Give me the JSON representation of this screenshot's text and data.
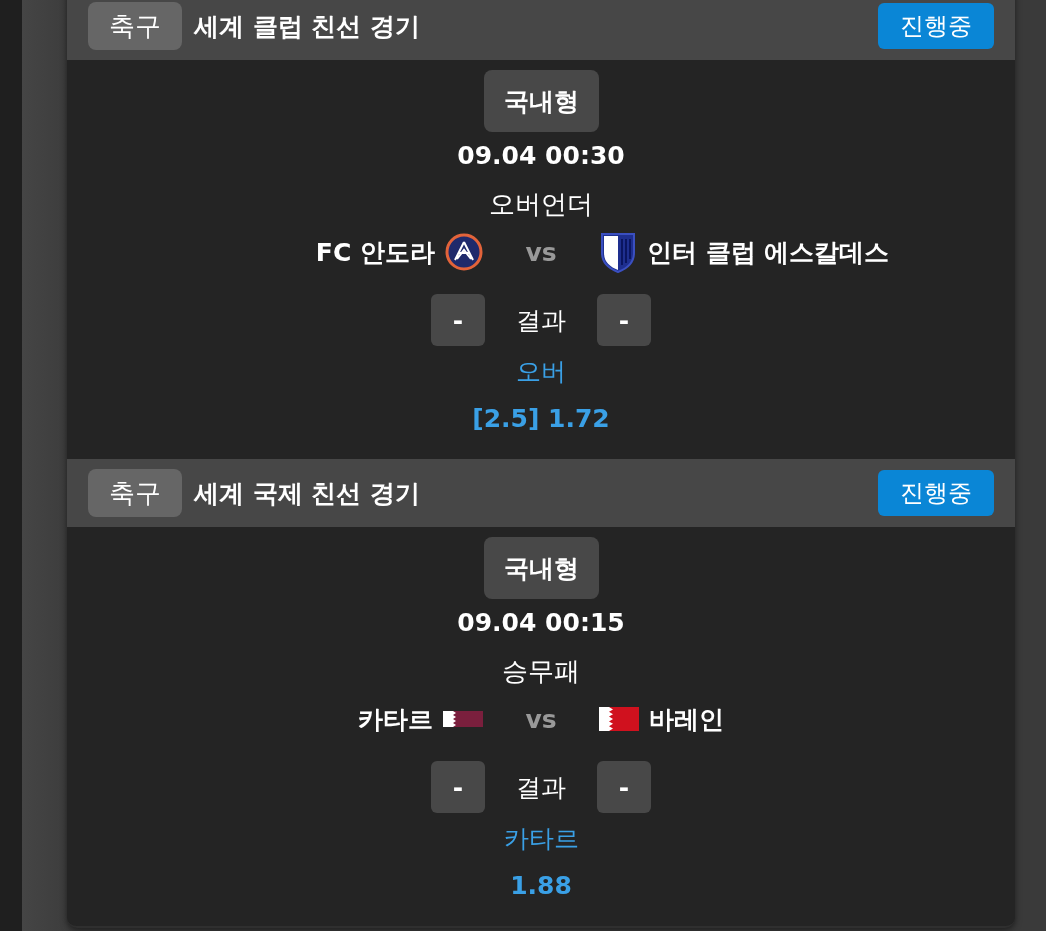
{
  "matches": [
    {
      "sport": "축구",
      "league": "세계 클럽 친선 경기",
      "status": "진행중",
      "bet_type": "국내형",
      "datetime": "09.04 00:30",
      "market": "오버언더",
      "home": {
        "name": "FC 안도라",
        "emblem": {
          "kind": "round-crest"
        }
      },
      "vs": "vs",
      "away": {
        "name": "인터 클럽 에스칼데스",
        "emblem": {
          "kind": "shield-crest"
        }
      },
      "score_home": "-",
      "result_label": "결과",
      "score_away": "-",
      "pick": "오버",
      "odds": "[2.5] 1.72"
    },
    {
      "sport": "축구",
      "league": "세계 국제 친선 경기",
      "status": "진행중",
      "bet_type": "국내형",
      "datetime": "09.04 00:15",
      "market": "승무패",
      "home": {
        "name": "카타르",
        "emblem": {
          "kind": "qatar-flag"
        }
      },
      "vs": "vs",
      "away": {
        "name": "바레인",
        "emblem": {
          "kind": "bahrain-flag"
        }
      },
      "score_home": "-",
      "result_label": "결과",
      "score_away": "-",
      "pick": "카타르",
      "odds": "1.88"
    }
  ]
}
